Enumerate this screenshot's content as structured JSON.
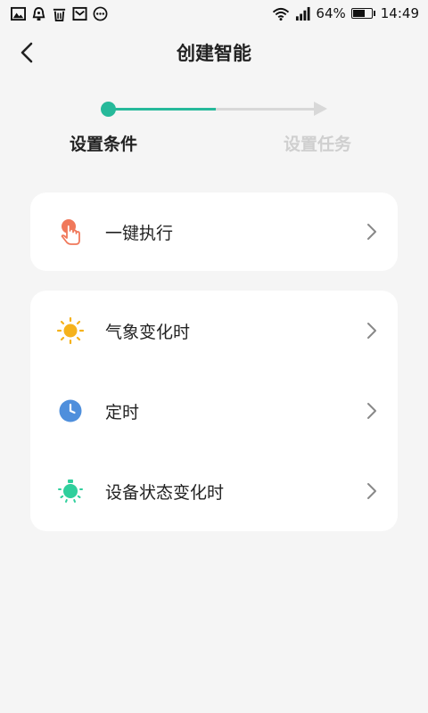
{
  "status_bar": {
    "left_icons": [
      "image-icon",
      "alarm-icon",
      "trash-icon",
      "mail-icon",
      "more-dots-icon"
    ],
    "battery_percent": "64%",
    "battery_level": 0.64,
    "time": "14:49"
  },
  "header": {
    "title": "创建智能"
  },
  "stepper": {
    "steps": [
      {
        "label": "设置条件",
        "active": true
      },
      {
        "label": "设置任务",
        "active": false
      }
    ],
    "accent_color": "#26b99a",
    "inactive_color": "#d8d8d8"
  },
  "card_1": {
    "items": [
      {
        "label": "一键执行",
        "icon": "tap-hand-icon",
        "icon_color": "#f0785a"
      }
    ]
  },
  "card_2": {
    "items": [
      {
        "label": "气象变化时",
        "icon": "sun-icon",
        "icon_color": "#f5b21c"
      },
      {
        "label": "定时",
        "icon": "clock-icon",
        "icon_color": "#4f8fdc"
      },
      {
        "label": "设备状态变化时",
        "icon": "device-bulb-icon",
        "icon_color": "#2fcf9c"
      }
    ]
  }
}
